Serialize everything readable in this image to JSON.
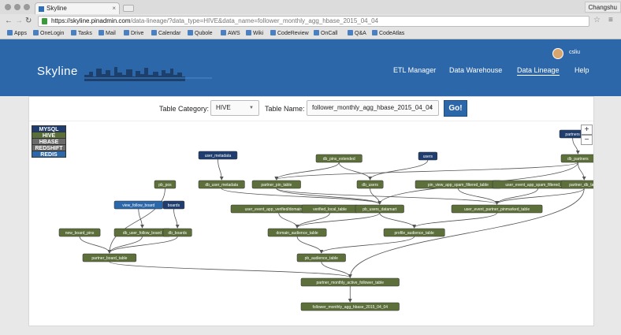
{
  "browser": {
    "tab_title": "Skyline",
    "profile_name": "Changshu",
    "url_host": "https://skyline.pinadmin.com",
    "url_path": "/data-lineage/?data_type=HIVE&data_name=follower_monthly_agg_hbase_2015_04_04"
  },
  "bookmarks": [
    {
      "label": "Apps"
    },
    {
      "label": "OneLogin"
    },
    {
      "label": "Tasks"
    },
    {
      "label": "Mail"
    },
    {
      "label": "Drive"
    },
    {
      "label": "Calendar"
    },
    {
      "label": "Qubole"
    },
    {
      "label": "AWS"
    },
    {
      "label": "Wiki"
    },
    {
      "label": "CodeReview"
    },
    {
      "label": "OnCall"
    },
    {
      "label": "Q&A"
    },
    {
      "label": "CodeAtlas"
    }
  ],
  "app": {
    "brand": "Skyline",
    "user": "csliu",
    "nav": [
      {
        "label": "ETL Manager",
        "active": false
      },
      {
        "label": "Data Warehouse",
        "active": false
      },
      {
        "label": "Data Lineage",
        "active": true
      },
      {
        "label": "Help",
        "active": false
      }
    ]
  },
  "controls": {
    "category_label": "Table Category:",
    "category_value": "HIVE",
    "name_label": "Table Name:",
    "name_value": "follower_monthly_agg_hbase_2015_04_04",
    "go_label": "Go!"
  },
  "legend": [
    {
      "label": "MYSQL",
      "color": "#1f3d6e"
    },
    {
      "label": "HIVE",
      "color": "#5a6e3a"
    },
    {
      "label": "HBASE",
      "color": "#6b6b6b"
    },
    {
      "label": "REDSHIFT",
      "color": "#6b6b6b"
    },
    {
      "label": "REDIS",
      "color": "#2c67a9"
    }
  ],
  "zoom": {
    "in": "+",
    "out": "−"
  },
  "colors": {
    "hive": "#5d6f3b",
    "mysql": "#1f3d6e",
    "redis": "#2c67a9",
    "edge": "#555555"
  },
  "nodes": [
    {
      "id": "partners",
      "label": "partners",
      "type": "mysql"
    },
    {
      "id": "user_metadata",
      "label": "user_metadata",
      "type": "mysql"
    },
    {
      "id": "users",
      "label": "users",
      "type": "mysql"
    },
    {
      "id": "view_follow_board",
      "label": "view_follow_board",
      "type": "redis"
    },
    {
      "id": "boards",
      "label": "boards",
      "type": "mysql"
    },
    {
      "id": "db_pins_extended",
      "label": "db_pins_extended",
      "type": "hive"
    },
    {
      "id": "db_partners",
      "label": "db_partners",
      "type": "hive"
    },
    {
      "id": "pb_pos",
      "label": "pb_pos",
      "type": "hive"
    },
    {
      "id": "db_user_metadata",
      "label": "db_user_metadata",
      "type": "hive"
    },
    {
      "id": "partner_pin_table",
      "label": "partner_pin_table",
      "type": "hive"
    },
    {
      "id": "db_users",
      "label": "db_users",
      "type": "hive"
    },
    {
      "id": "pin_view_app_spam",
      "label": "pin_view_app_spam_filtered_table",
      "type": "hive"
    },
    {
      "id": "user_event_app_spam",
      "label": "user_event_app_spam_filtered_table",
      "type": "hive"
    },
    {
      "id": "partner_db_table",
      "label": "partner_db_table",
      "type": "hive"
    },
    {
      "id": "user_event_app_verified",
      "label": "user_event_app_verified/domain_table",
      "type": "hive"
    },
    {
      "id": "verified_local_table",
      "label": "verified_local_table",
      "type": "hive"
    },
    {
      "id": "pb_users_datamart",
      "label": "pb_users_datamart",
      "type": "hive"
    },
    {
      "id": "user_event_partner",
      "label": "user_event_partner_pinmarked_table",
      "type": "hive"
    },
    {
      "id": "new_board_pins",
      "label": "new_board_pins",
      "type": "hive"
    },
    {
      "id": "db_user_follow_board",
      "label": "db_user_follow_board",
      "type": "hive"
    },
    {
      "id": "db_boards",
      "label": "db_boards",
      "type": "hive"
    },
    {
      "id": "domain_audience_table",
      "label": "domain_audience_table",
      "type": "hive"
    },
    {
      "id": "profile_audience_table",
      "label": "profile_audience_table",
      "type": "hive"
    },
    {
      "id": "partner_board_table",
      "label": "partner_board_table",
      "type": "hive"
    },
    {
      "id": "pb_audience_table",
      "label": "pb_audience_table",
      "type": "hive"
    },
    {
      "id": "partner_monthly",
      "label": "partner_monthly_active_follower_table",
      "type": "hive"
    },
    {
      "id": "follower_monthly",
      "label": "follower_monthly_agg_hbase_2015_04_04",
      "type": "hive"
    }
  ],
  "edges": [
    [
      "partners",
      "db_partners"
    ],
    [
      "user_metadata",
      "db_user_metadata"
    ],
    [
      "users",
      "db_users"
    ],
    [
      "view_follow_board",
      "db_user_follow_board"
    ],
    [
      "boards",
      "db_boards"
    ],
    [
      "db_pins_extended",
      "partner_pin_table"
    ],
    [
      "db_pins_extended",
      "db_users"
    ],
    [
      "db_partners",
      "partner_pin_table"
    ],
    [
      "db_partners",
      "partner_db_table"
    ],
    [
      "db_partners",
      "pb_users_datamart"
    ],
    [
      "pb_pos",
      "partner_board_table"
    ],
    [
      "db_user_metadata",
      "pb_users_datamart"
    ],
    [
      "partner_pin_table",
      "pb_users_datamart"
    ],
    [
      "partner_pin_table",
      "user_event_partner"
    ],
    [
      "db_users",
      "pb_users_datamart"
    ],
    [
      "pin_view_app_spam",
      "user_event_partner"
    ],
    [
      "user_event_app_spam",
      "user_event_partner"
    ],
    [
      "partner_db_table",
      "user_event_partner"
    ],
    [
      "user_event_app_verified",
      "domain_audience_table"
    ],
    [
      "verified_local_table",
      "domain_audience_table"
    ],
    [
      "pb_users_datamart",
      "domain_audience_table"
    ],
    [
      "pb_users_datamart",
      "profile_audience_table"
    ],
    [
      "user_event_partner",
      "profile_audience_table"
    ],
    [
      "new_board_pins",
      "partner_board_table"
    ],
    [
      "db_user_follow_board",
      "partner_board_table"
    ],
    [
      "db_boards",
      "partner_board_table"
    ],
    [
      "domain_audience_table",
      "pb_audience_table"
    ],
    [
      "profile_audience_table",
      "pb_audience_table"
    ],
    [
      "partner_board_table",
      "partner_monthly"
    ],
    [
      "pb_audience_table",
      "partner_monthly"
    ],
    [
      "partner_db_table",
      "partner_monthly"
    ],
    [
      "partner_monthly",
      "follower_monthly"
    ]
  ]
}
